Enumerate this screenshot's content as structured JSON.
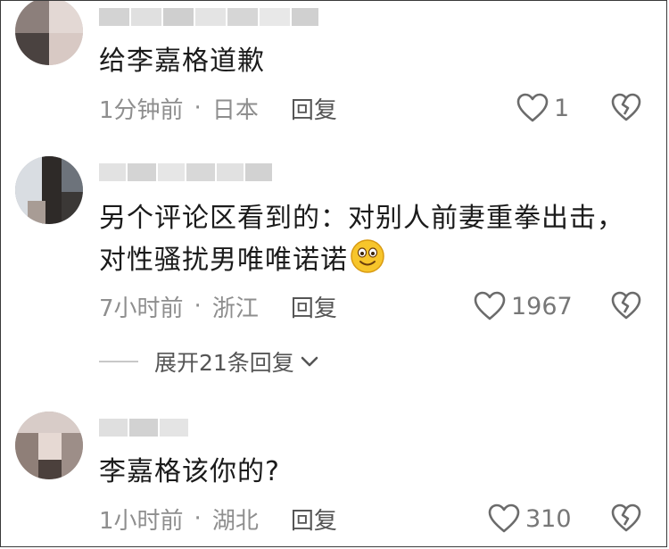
{
  "comments": [
    {
      "text_lines": [
        "给李嘉格道歉"
      ],
      "time": "1分钟前",
      "location": "日本",
      "reply_label": "回复",
      "likes": "1"
    },
    {
      "text_lines": [
        "另个评论区看到的：对别人前妻重拳出击，",
        "对性骚扰男唯唯诺诺"
      ],
      "time": "7小时前",
      "location": "浙江",
      "reply_label": "回复",
      "likes": "1967",
      "expand_label": "展开21条回复"
    },
    {
      "text_lines": [
        "李嘉格该你的?"
      ],
      "time": "1小时前",
      "location": "湖北",
      "reply_label": "回复",
      "likes": "310"
    }
  ],
  "separator": "·",
  "icons": {
    "like": "heart-outline-icon",
    "dislike": "broken-heart-icon",
    "expand": "chevron-down-icon",
    "emoji": "smiling-face-emoji"
  },
  "colors": {
    "text": "#1b1b1b",
    "meta": "#8e8e8e",
    "icon": "#6b6b6b",
    "emoji_yellow": "#f7c52b"
  }
}
